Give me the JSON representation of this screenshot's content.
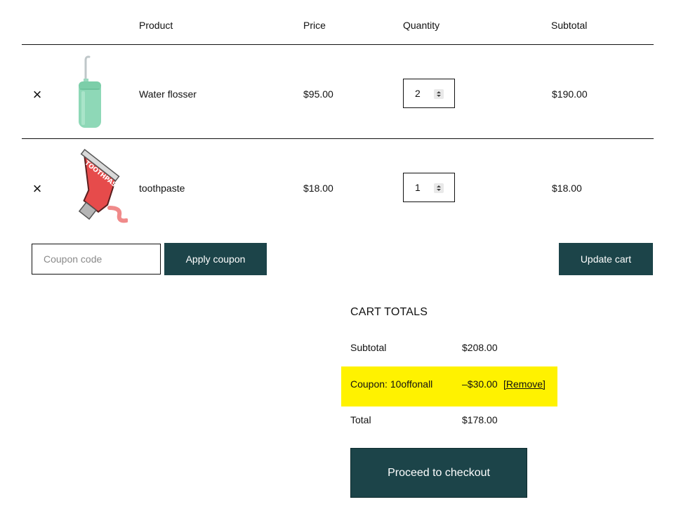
{
  "table": {
    "headers": {
      "product": "Product",
      "price": "Price",
      "quantity": "Quantity",
      "subtotal": "Subtotal"
    },
    "rows": [
      {
        "remove_icon": "×",
        "name": "Water flosser",
        "price": "$95.00",
        "quantity": "2",
        "subtotal": "$190.00",
        "image": "water-flosser"
      },
      {
        "remove_icon": "×",
        "name": "toothpaste",
        "price": "$18.00",
        "quantity": "1",
        "subtotal": "$18.00",
        "image": "toothpaste-tube"
      }
    ]
  },
  "coupon": {
    "placeholder": "Coupon code",
    "apply_label": "Apply coupon"
  },
  "update_label": "Update cart",
  "totals": {
    "title": "CART TOTALS",
    "subtotal_label": "Subtotal",
    "subtotal_value": "$208.00",
    "coupon_label": "Coupon: 10offonall",
    "coupon_value": "–$30.00",
    "coupon_remove": "[Remove]",
    "total_label": "Total",
    "total_value": "$178.00",
    "checkout_label": "Proceed to checkout"
  },
  "colors": {
    "button": "#1c4449",
    "coupon_highlight": "#fff200"
  },
  "toothpaste_logo_text": "TOOTHPASTE"
}
